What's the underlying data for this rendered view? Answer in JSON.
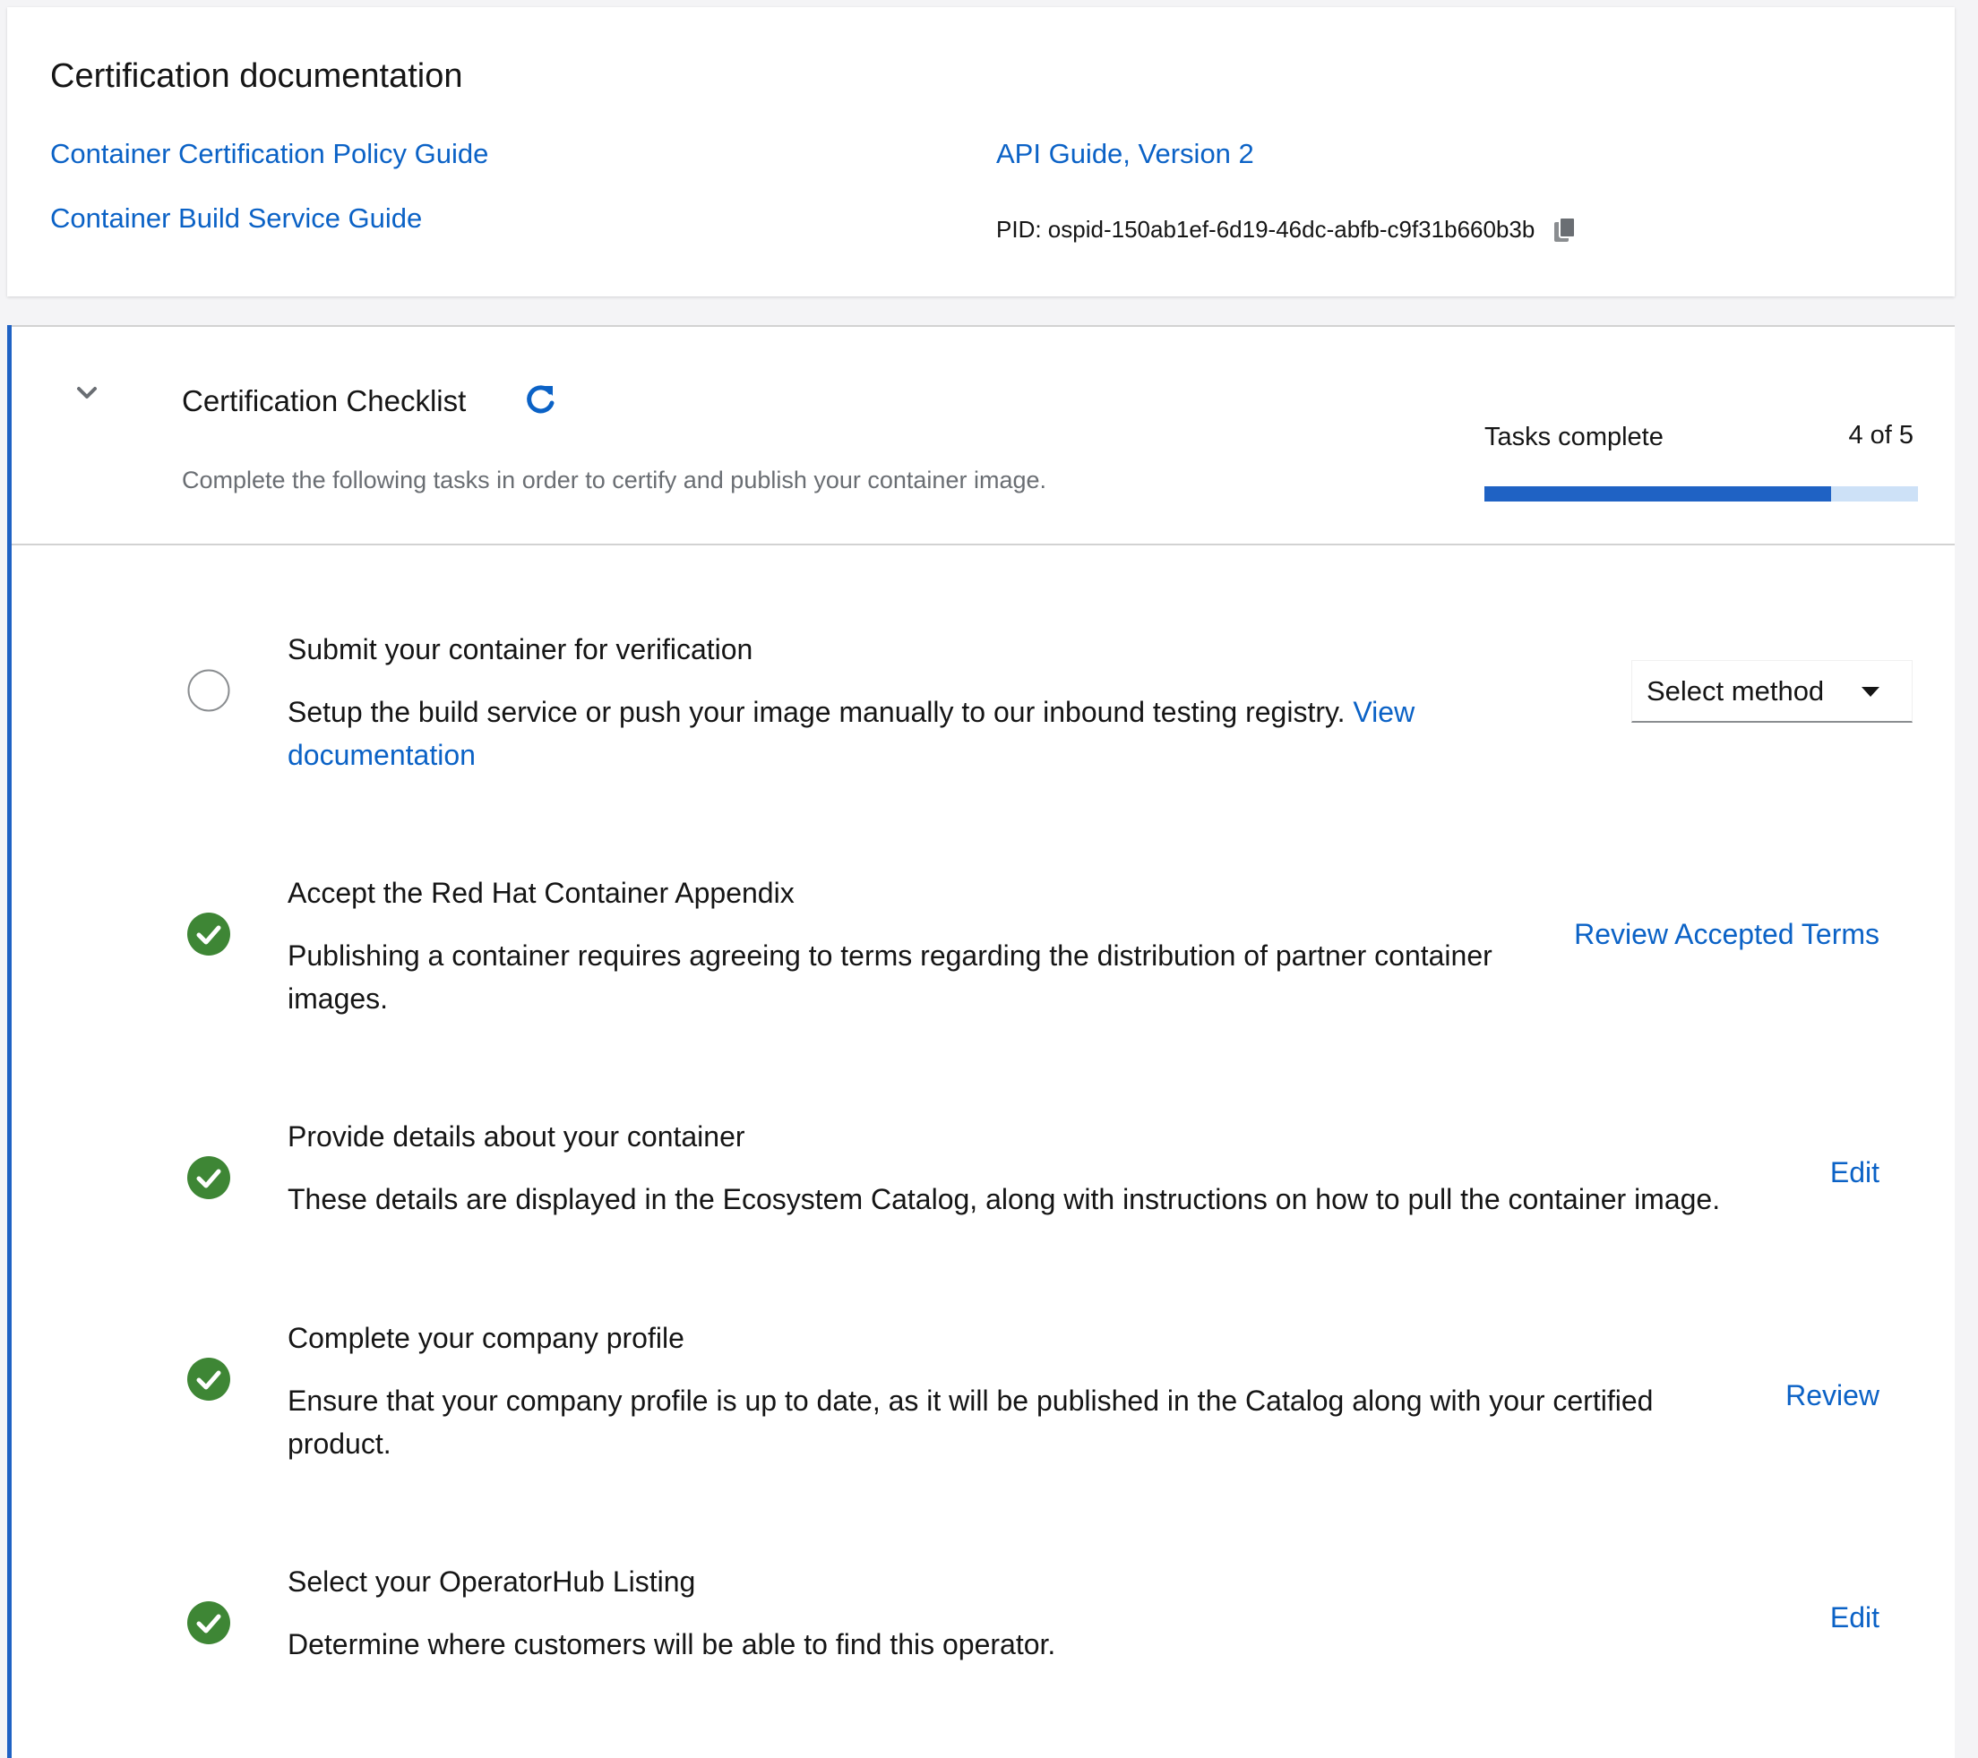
{
  "documentation": {
    "title": "Certification documentation",
    "links": {
      "policy_guide": "Container Certification Policy Guide",
      "build_service_guide": "Container Build Service Guide",
      "api_guide": "API Guide, Version 2"
    },
    "pid_text": "PID: ospid-150ab1ef-6d19-46dc-abfb-c9f31b660b3b",
    "copy_icon": "copy-icon"
  },
  "checklist": {
    "title": "Certification Checklist",
    "description": "Complete the following tasks in order to certify and publish your container image.",
    "progress": {
      "label": "Tasks complete",
      "value_text": "4 of 5",
      "completed": 4,
      "total": 5
    },
    "tasks": [
      {
        "title": "Submit your container for verification",
        "description": "Setup the build service or push your image manually to our inbound testing registry.",
        "link": "View documentation",
        "status": "incomplete",
        "select_label": "Select method"
      },
      {
        "title": "Accept the Red Hat Container Appendix",
        "description": "Publishing a container requires agreeing to terms regarding the distribution of partner container images.",
        "status": "complete",
        "action": "Review Accepted Terms"
      },
      {
        "title": "Provide details about your container",
        "description": "These details are displayed in the Ecosystem Catalog, along with instructions on how to pull the container image.",
        "status": "complete",
        "action": "Edit"
      },
      {
        "title": "Complete your company profile",
        "description": "Ensure that your company profile is up to date, as it will be published in the Catalog along with your certified product.",
        "status": "complete",
        "action": "Review"
      },
      {
        "title": "Select your OperatorHub Listing",
        "description": "Determine where customers will be able to find this operator.",
        "status": "complete",
        "action": "Edit"
      }
    ]
  },
  "colors": {
    "link": "#0b62c6",
    "accent": "#1f62c4",
    "success": "#3e8635"
  }
}
